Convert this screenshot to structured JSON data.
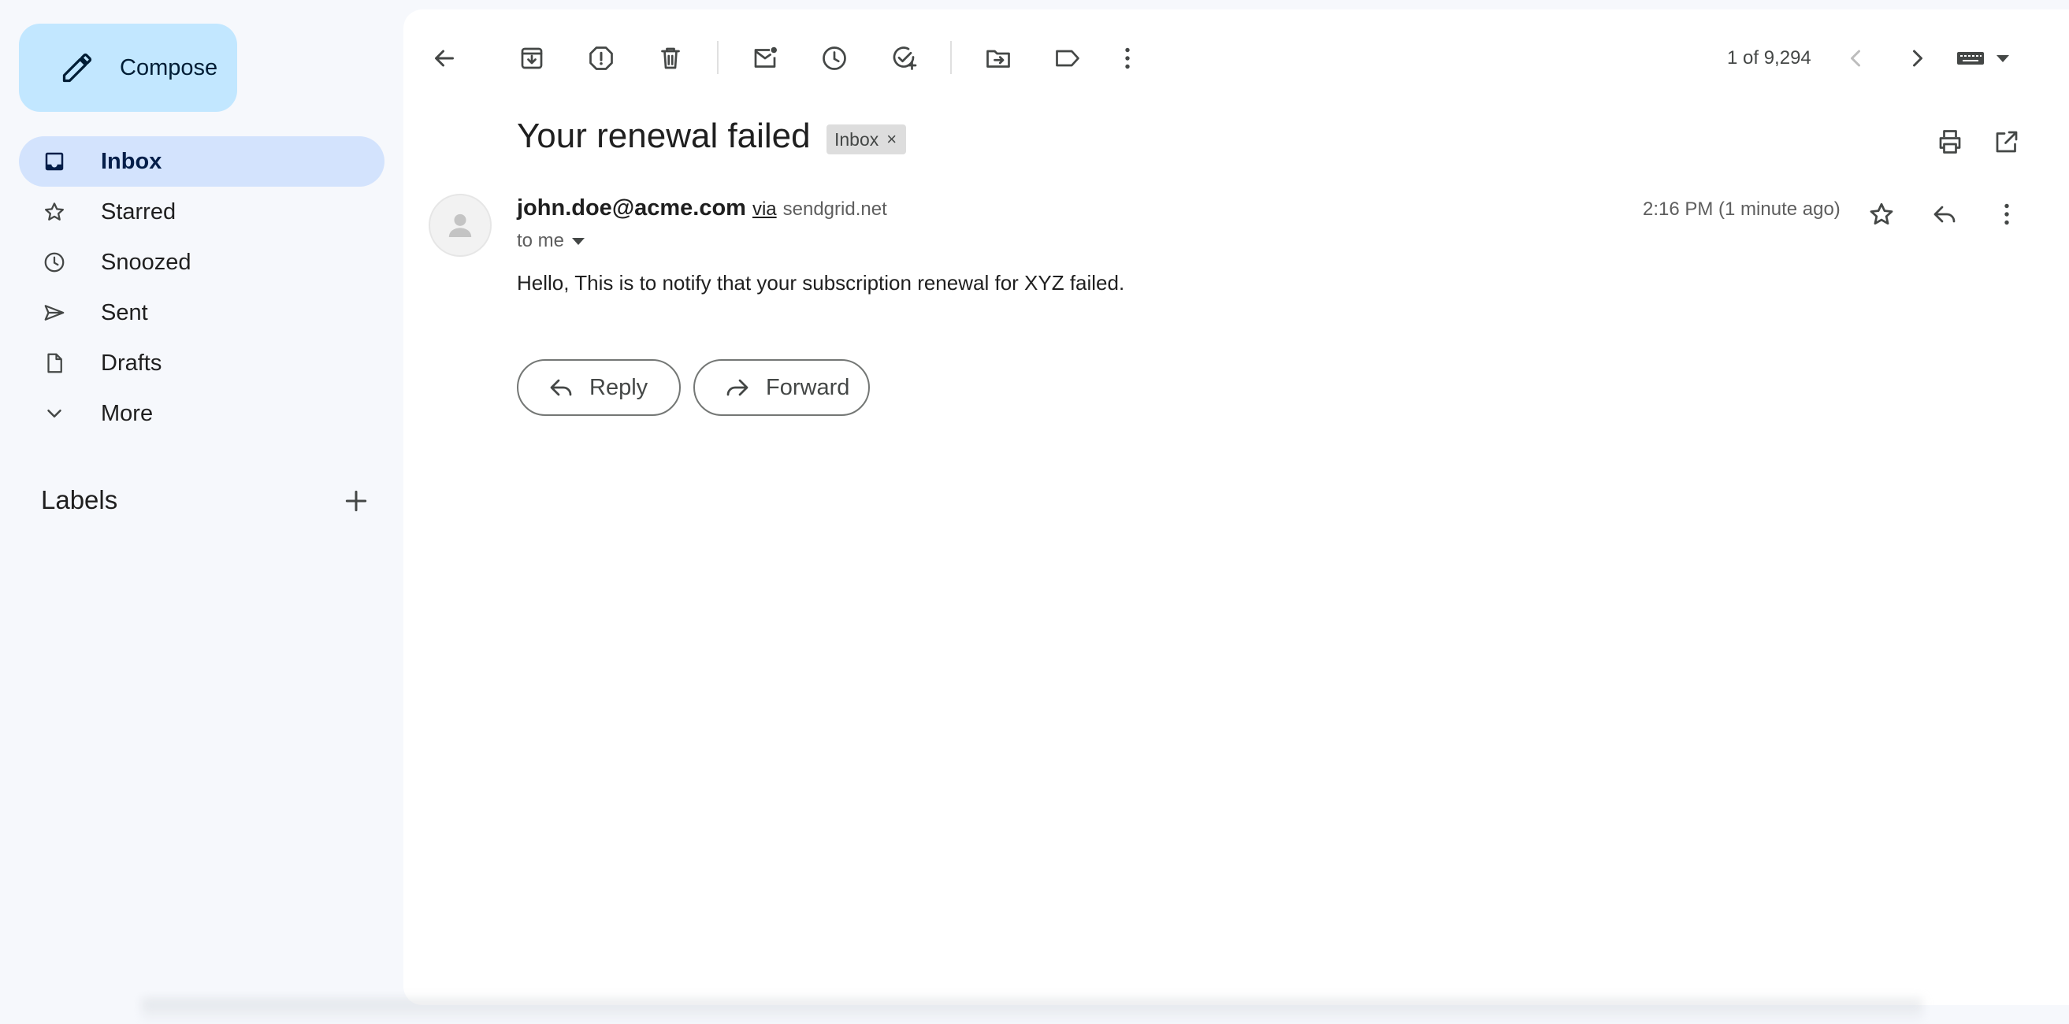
{
  "sidebar": {
    "compose_label": "Compose",
    "items": [
      {
        "label": "Inbox",
        "icon": "inbox-icon",
        "active": true
      },
      {
        "label": "Starred",
        "icon": "star-icon"
      },
      {
        "label": "Snoozed",
        "icon": "clock-icon"
      },
      {
        "label": "Sent",
        "icon": "send-icon"
      },
      {
        "label": "Drafts",
        "icon": "draft-icon"
      },
      {
        "label": "More",
        "icon": "chevron-down-icon"
      }
    ],
    "labels_title": "Labels"
  },
  "toolbar": {
    "icons": [
      "back-arrow-icon",
      "archive-icon",
      "report-spam-icon",
      "delete-icon",
      "mark-unread-icon",
      "snooze-icon",
      "add-task-icon",
      "move-to-icon",
      "label-icon",
      "more-vert-icon"
    ],
    "pager_text": "1 of 9,294"
  },
  "message": {
    "subject": "Your renewal failed",
    "label_chip": "Inbox",
    "chip_close": "×",
    "sender_email": "john.doe@acme.com",
    "via": "via",
    "via_domain": "sendgrid.net",
    "recipient": "to me",
    "time": "2:16 PM (1 minute ago)",
    "body": "Hello, This is to notify that your subscription renewal for XYZ failed."
  },
  "actions": {
    "reply_label": "Reply",
    "forward_label": "Forward"
  },
  "colors": {
    "background": "#f6f8fc",
    "compose": "#c2e7ff",
    "active_nav": "#d3e3fd",
    "chip": "#dddddd"
  }
}
